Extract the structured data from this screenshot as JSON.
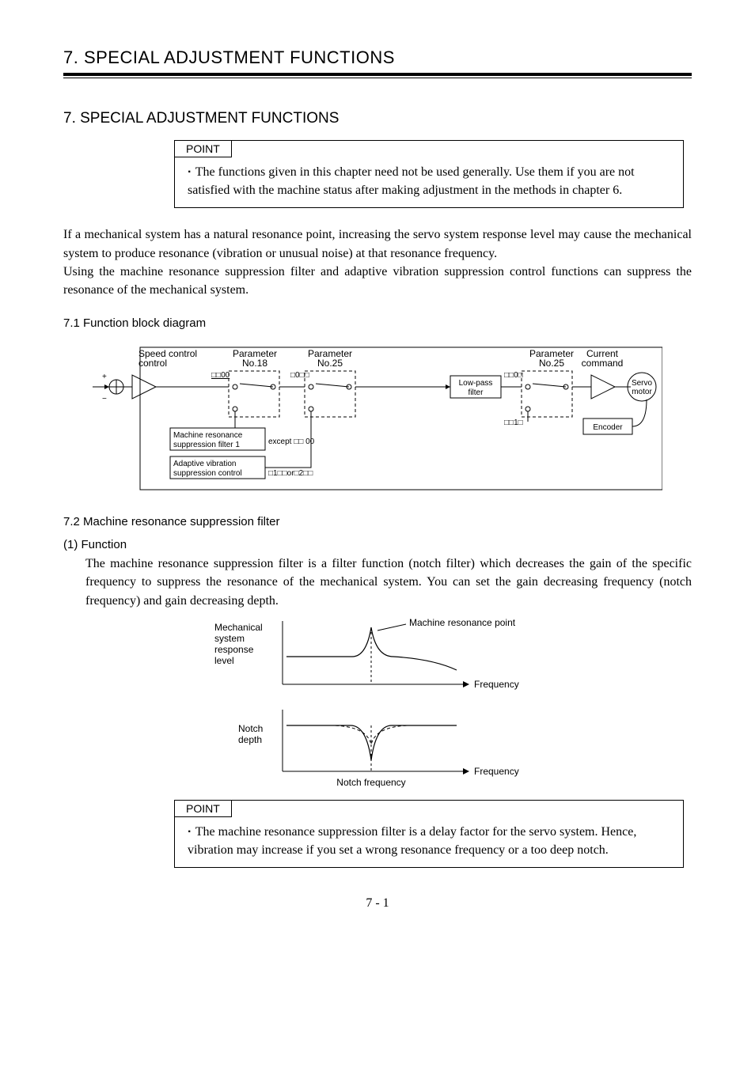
{
  "header": {
    "running_head": "7. SPECIAL ADJUSTMENT FUNCTIONS"
  },
  "chapter_title": "7. SPECIAL ADJUSTMENT FUNCTIONS",
  "point1": {
    "label": "POINT",
    "text": "The functions given in this chapter need not be used generally. Use them if you are not satisfied with the machine status after making adjustment in the methods in chapter 6."
  },
  "intro_para": "If a mechanical system has a natural resonance point, increasing the servo system response level may cause the mechanical system to produce resonance (vibration or unusual noise) at that resonance frequency.\nUsing the machine resonance suppression filter and adaptive vibration suppression control functions can suppress the resonance of the mechanical system.",
  "section71": {
    "heading": "7.1 Function block diagram",
    "diagram": {
      "speed_control": "Speed\ncontrol",
      "param18": "Parameter\nNo.18",
      "param25_left": "Parameter\nNo.25",
      "param25_right": "Parameter\nNo.25",
      "current_cmd": "Current\ncommand",
      "lowpass": "Low-pass\nfilter",
      "servo_motor": "Servo\nmotor",
      "encoder": "Encoder",
      "box1": "Machine resonance\nsuppression filter 1",
      "box2": "Adaptive vibration\nsuppression control",
      "sw1_code": "□□00",
      "sw2_code": "□0□□",
      "sw3_code": "□□0□",
      "sw4_code": "□□1□",
      "except_code": "except □□ 00",
      "or_code": "□1□□or□2□□"
    }
  },
  "section72": {
    "heading": "7.2 Machine resonance suppression filter",
    "sub1": "(1) Function",
    "para": "The machine resonance suppression filter is a filter function (notch filter) which decreases the gain of the specific frequency to suppress the resonance of the mechanical system. You can set the gain decreasing frequency (notch frequency) and gain decreasing depth.",
    "graph": {
      "y1": "Mechanical\nsystem\nresponse\nlevel",
      "res_pt": "Machine resonance point",
      "freq": "Frequency",
      "notch_depth": "Notch\ndepth",
      "notch_freq": "Notch frequency"
    }
  },
  "point2": {
    "label": "POINT",
    "text": "The machine resonance suppression filter is a delay factor for the servo system. Hence, vibration may increase if you set a wrong resonance frequency or a too deep notch."
  },
  "page_number": "7 - 1"
}
